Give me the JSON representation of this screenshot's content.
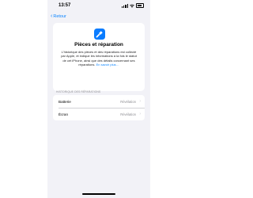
{
  "status_bar": {
    "time": "13:57"
  },
  "nav": {
    "back_label": "Retour"
  },
  "card": {
    "title": "Pièces et réparation",
    "body": "L'historique des pièces et des réparations est collecté par Apple, et indique les informations à la fois le statut de cet iPhone, ainsi que des détails concernant ses réparations.",
    "link": "En savoir plus…",
    "icon": "screwdriver-icon",
    "icon_color": "#0a7cff"
  },
  "history": {
    "header": "HISTORIQUE DES RÉPARATIONS",
    "rows": [
      {
        "label": "Batterie",
        "value": "Révélation"
      },
      {
        "label": "Écran",
        "value": "Révélation"
      }
    ]
  },
  "colors": {
    "accent": "#0a84ff",
    "background": "#f2f2f7"
  }
}
